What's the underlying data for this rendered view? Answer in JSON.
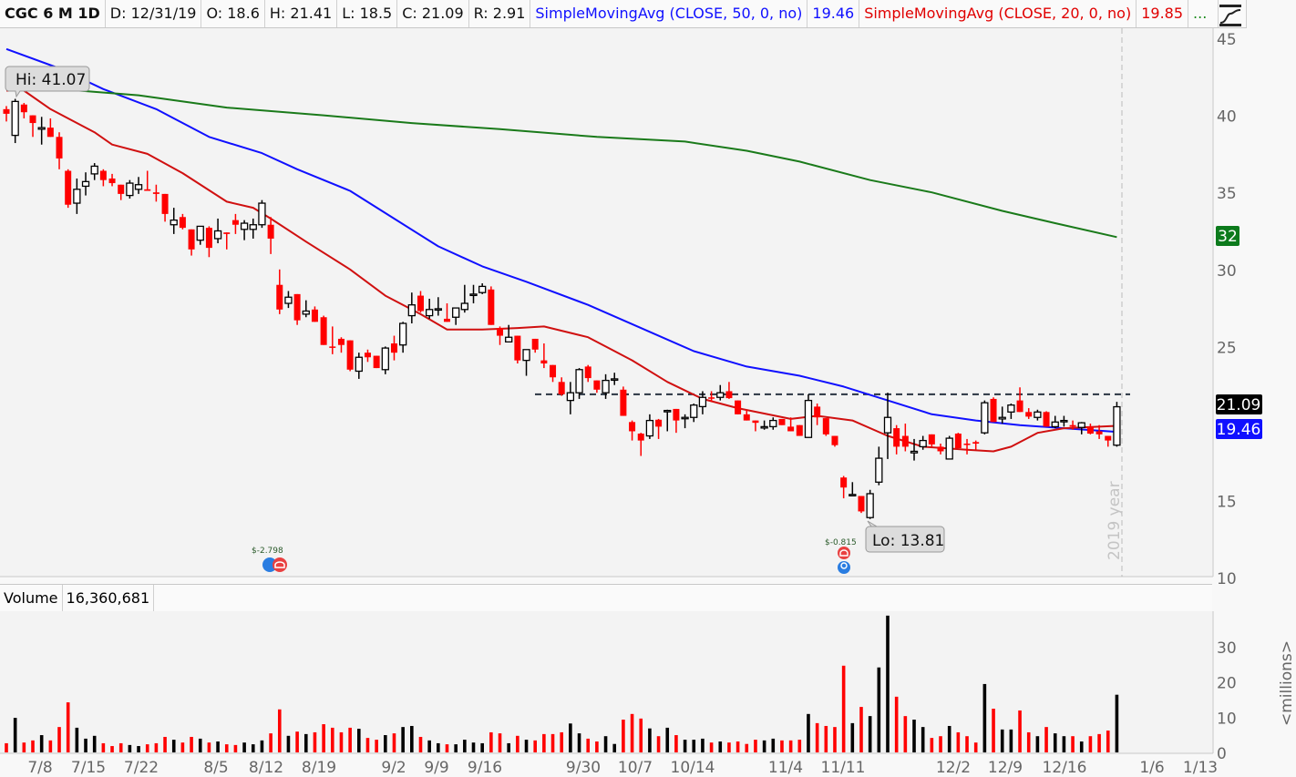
{
  "header": {
    "symbol": "CGC 6 M 1D",
    "date": "D: 12/31/19",
    "open": "O: 18.6",
    "high": "H: 21.41",
    "low": "L: 18.5",
    "close": "C: 21.09",
    "range": "R: 2.91",
    "sma50_label": "SimpleMovingAvg (CLOSE, 50, 0, no)",
    "sma50_value": "19.46",
    "sma20_label": "SimpleMovingAvg (CLOSE, 20, 0, no)",
    "sma20_value": "19.85",
    "more": "..."
  },
  "volume_header": {
    "label": "Volume",
    "value": "16,360,681"
  },
  "annotations": {
    "hi_label": "Hi: 41.07",
    "lo_label": "Lo: 13.81",
    "year_marker": "2019 year",
    "earnings_1": "$-2.798",
    "earnings_2": "$-0.815",
    "horizontal_line_price": 21.9
  },
  "price_labels": {
    "last": "21.09",
    "sma50": "19.46",
    "sma200": "32"
  },
  "colors": {
    "up_candle": "#000000",
    "down_candle": "#ff0000",
    "sma50": "#1010ff",
    "sma20": "#d01010",
    "sma200": "#1a7a1a",
    "volume_r": "#ff0000",
    "volume_k": "#000000"
  },
  "icons": {
    "style": "chart-style-icon",
    "earnings": "phone-icon",
    "dividend": "bulb-icon"
  },
  "chart_data": [
    {
      "type": "candlestick",
      "ylim": [
        10,
        45
      ],
      "y_ticks": [
        "45",
        "40",
        "35",
        "30",
        "25",
        "15",
        "10"
      ],
      "x_ticks": [
        "7/8",
        "7/15",
        "7/22",
        "8/5",
        "8/12",
        "8/19",
        "9/2",
        "9/9",
        "9/16",
        "9/30",
        "10/7",
        "10/14",
        "11/4",
        "11/11",
        "12/2",
        "12/9",
        "12/16",
        "1/6",
        "1/13"
      ],
      "grid": false,
      "ohlc": [
        [
          40.4,
          40.6,
          39.6,
          40.1
        ],
        [
          38.7,
          41.07,
          38.2,
          40.9
        ],
        [
          40.7,
          40.8,
          39.8,
          40.2
        ],
        [
          40.0,
          40.0,
          38.6,
          39.5
        ],
        [
          39.1,
          39.9,
          38.1,
          39.2
        ],
        [
          39.2,
          39.8,
          38.6,
          38.6
        ],
        [
          38.6,
          38.9,
          36.5,
          37.2
        ],
        [
          36.4,
          36.5,
          34.0,
          34.2
        ],
        [
          34.3,
          35.9,
          33.6,
          35.2
        ],
        [
          35.4,
          36.3,
          34.8,
          35.7
        ],
        [
          36.2,
          36.9,
          35.8,
          36.7
        ],
        [
          36.4,
          36.5,
          35.4,
          35.8
        ],
        [
          35.9,
          36.2,
          35.4,
          35.6
        ],
        [
          35.5,
          35.5,
          34.5,
          34.9
        ],
        [
          34.8,
          35.8,
          34.6,
          35.6
        ],
        [
          35.2,
          36.0,
          34.9,
          35.5
        ],
        [
          35.2,
          36.4,
          35.1,
          35.1
        ],
        [
          35.0,
          35.5,
          34.4,
          34.9
        ],
        [
          34.9,
          34.9,
          33.1,
          33.6
        ],
        [
          32.9,
          34.0,
          32.3,
          33.2
        ],
        [
          33.4,
          33.6,
          32.6,
          32.7
        ],
        [
          32.6,
          32.6,
          30.9,
          31.3
        ],
        [
          31.9,
          32.8,
          31.6,
          32.8
        ],
        [
          32.7,
          32.8,
          30.8,
          31.4
        ],
        [
          32.0,
          33.3,
          31.7,
          32.5
        ],
        [
          32.4,
          32.4,
          31.3,
          32.3
        ],
        [
          33.2,
          33.6,
          32.3,
          32.9
        ],
        [
          32.6,
          33.2,
          31.9,
          33.0
        ],
        [
          32.6,
          33.3,
          32.0,
          32.9
        ],
        [
          32.9,
          34.5,
          32.7,
          34.3
        ],
        [
          32.9,
          33.4,
          31.0,
          32.0
        ],
        [
          29.0,
          30.0,
          27.1,
          27.4
        ],
        [
          27.8,
          28.6,
          27.5,
          28.2
        ],
        [
          28.4,
          28.4,
          26.4,
          26.7
        ],
        [
          27.1,
          28.0,
          26.9,
          27.3
        ],
        [
          27.4,
          27.6,
          26.6,
          26.6
        ],
        [
          26.9,
          27.0,
          25.1,
          25.1
        ],
        [
          25.0,
          26.3,
          24.5,
          24.95
        ],
        [
          25.5,
          25.6,
          24.6,
          25.1
        ],
        [
          25.4,
          25.4,
          23.4,
          23.5
        ],
        [
          23.4,
          24.6,
          22.9,
          24.3
        ],
        [
          24.6,
          24.8,
          24.0,
          24.3
        ],
        [
          24.4,
          24.4,
          23.6,
          23.6
        ],
        [
          23.5,
          25.0,
          23.2,
          24.9
        ],
        [
          25.2,
          25.7,
          24.1,
          24.6
        ],
        [
          25.1,
          26.6,
          24.6,
          26.5
        ],
        [
          27.0,
          28.5,
          26.5,
          27.7
        ],
        [
          28.3,
          28.6,
          27.2,
          27.3
        ],
        [
          27.0,
          28.1,
          26.8,
          27.4
        ],
        [
          27.4,
          28.2,
          27.0,
          27.45
        ],
        [
          26.8,
          27.8,
          26.6,
          26.6
        ],
        [
          26.9,
          27.5,
          26.4,
          27.5
        ],
        [
          27.4,
          29.0,
          27.2,
          27.8
        ],
        [
          28.35,
          29.0,
          27.8,
          28.4
        ],
        [
          28.5,
          29.1,
          28.4,
          28.9
        ],
        [
          28.7,
          28.9,
          26.4,
          26.4
        ],
        [
          26.2,
          26.3,
          25.1,
          25.7
        ],
        [
          25.3,
          26.4,
          25.3,
          25.6
        ],
        [
          25.7,
          25.7,
          23.9,
          24.1
        ],
        [
          24.1,
          24.8,
          23.1,
          24.8
        ],
        [
          25.5,
          25.5,
          24.6,
          24.8
        ],
        [
          24.1,
          25.2,
          23.6,
          23.9
        ],
        [
          23.8,
          23.8,
          22.7,
          23.0
        ],
        [
          22.7,
          23.0,
          21.8,
          21.9
        ],
        [
          21.5,
          22.7,
          20.6,
          22.0
        ],
        [
          22.0,
          23.6,
          21.6,
          23.5
        ],
        [
          23.7,
          23.8,
          22.7,
          22.95
        ],
        [
          22.8,
          22.8,
          22.0,
          22.2
        ],
        [
          22.0,
          23.2,
          21.6,
          22.8
        ],
        [
          22.85,
          23.3,
          22.5,
          22.9
        ],
        [
          22.2,
          22.4,
          20.5,
          20.5
        ],
        [
          20.1,
          20.2,
          18.9,
          19.5
        ],
        [
          19.35,
          19.4,
          17.9,
          18.9
        ],
        [
          19.2,
          20.6,
          19.0,
          20.2
        ],
        [
          20.25,
          20.3,
          19.0,
          19.8
        ],
        [
          20.8,
          20.9,
          19.5,
          20.85
        ],
        [
          20.95,
          20.95,
          19.4,
          20.2
        ],
        [
          20.35,
          20.6,
          19.7,
          20.4
        ],
        [
          20.4,
          21.3,
          20.1,
          21.2
        ],
        [
          21.1,
          22.1,
          20.6,
          21.7
        ],
        [
          21.7,
          22.1,
          21.4,
          21.65
        ],
        [
          21.7,
          22.5,
          21.5,
          22.0
        ],
        [
          22.1,
          22.7,
          21.6,
          21.65
        ],
        [
          21.5,
          21.5,
          20.6,
          20.6
        ],
        [
          20.6,
          20.9,
          20.2,
          20.2
        ],
        [
          20.2,
          20.2,
          19.5,
          20.05
        ],
        [
          19.75,
          20.2,
          19.6,
          19.8
        ],
        [
          19.8,
          20.4,
          19.6,
          20.2
        ],
        [
          20.3,
          20.3,
          19.9,
          19.9
        ],
        [
          19.8,
          20.4,
          19.5,
          19.5
        ],
        [
          19.9,
          19.9,
          19.2,
          19.2
        ],
        [
          19.1,
          21.9,
          19.1,
          21.5
        ],
        [
          21.1,
          21.3,
          19.9,
          20.4
        ],
        [
          20.35,
          20.35,
          19.2,
          19.3
        ],
        [
          19.2,
          19.2,
          18.5,
          18.6
        ],
        [
          16.5,
          16.6,
          15.15,
          15.85
        ],
        [
          15.35,
          16.2,
          15.3,
          15.4
        ],
        [
          15.3,
          15.3,
          14.2,
          14.3
        ],
        [
          13.9,
          15.7,
          13.81,
          15.45
        ],
        [
          16.2,
          18.5,
          16.0,
          17.75
        ],
        [
          19.4,
          22.0,
          17.7,
          20.4
        ],
        [
          19.7,
          19.9,
          18.0,
          18.5
        ],
        [
          19.2,
          20.0,
          18.2,
          18.5
        ],
        [
          18.1,
          19.0,
          17.6,
          18.2
        ],
        [
          18.5,
          19.2,
          18.3,
          18.9
        ],
        [
          19.3,
          19.3,
          18.5,
          18.65
        ],
        [
          18.5,
          18.7,
          18.0,
          18.2
        ],
        [
          17.7,
          19.2,
          17.7,
          19.05
        ],
        [
          19.35,
          19.4,
          18.4,
          18.4
        ],
        [
          18.7,
          19.0,
          18.0,
          18.65
        ],
        [
          18.8,
          18.9,
          18.3,
          18.7
        ],
        [
          19.4,
          21.5,
          19.3,
          21.35
        ],
        [
          21.6,
          21.7,
          20.1,
          20.1
        ],
        [
          20.3,
          21.1,
          20.0,
          20.4
        ],
        [
          20.75,
          21.3,
          20.3,
          21.2
        ],
        [
          21.5,
          22.35,
          20.75,
          20.75
        ],
        [
          20.75,
          21.0,
          20.3,
          20.45
        ],
        [
          20.4,
          20.9,
          20.2,
          20.75
        ],
        [
          20.75,
          20.8,
          19.8,
          19.8
        ],
        [
          19.8,
          20.5,
          19.7,
          20.1
        ],
        [
          20.15,
          20.5,
          19.8,
          20.2
        ],
        [
          19.9,
          20.2,
          19.6,
          19.8
        ],
        [
          19.75,
          20.1,
          19.3,
          20.05
        ],
        [
          19.8,
          20.0,
          19.3,
          19.35
        ],
        [
          19.5,
          19.9,
          19.0,
          19.3
        ],
        [
          19.2,
          19.2,
          18.5,
          18.9
        ],
        [
          18.6,
          21.41,
          18.5,
          21.09
        ]
      ],
      "series": [
        {
          "name": "SimpleMovingAvg (CLOSE, 50, 0, no)",
          "points": [
            [
              0,
              44.3
            ],
            [
              6,
              43.05
            ],
            [
              11,
              41.7
            ],
            [
              17,
              40.4
            ],
            [
              23,
              38.6
            ],
            [
              29,
              37.55
            ],
            [
              33,
              36.5
            ],
            [
              39,
              35.1
            ],
            [
              44,
              33.3
            ],
            [
              49,
              31.5
            ],
            [
              54,
              30.2
            ],
            [
              59,
              29.2
            ],
            [
              66,
              27.7
            ],
            [
              72,
              26.2
            ],
            [
              78,
              24.7
            ],
            [
              84,
              23.7
            ],
            [
              90,
              23.1
            ],
            [
              95,
              22.4
            ],
            [
              100,
              21.5
            ],
            [
              105,
              20.6
            ],
            [
              110,
              20.2
            ],
            [
              115,
              19.9
            ],
            [
              120,
              19.7
            ],
            [
              126,
              19.46
            ]
          ]
        },
        {
          "name": "SimpleMovingAvg (CLOSE, 20, 0, no)",
          "points": [
            [
              0,
              41.6
            ],
            [
              2,
              41.6
            ],
            [
              5,
              40.4
            ],
            [
              10,
              38.9
            ],
            [
              12,
              38.1
            ],
            [
              16,
              37.5
            ],
            [
              20,
              36.25
            ],
            [
              25,
              34.4
            ],
            [
              28,
              34.0
            ],
            [
              30,
              33.3
            ],
            [
              34,
              31.8
            ],
            [
              39,
              30.0
            ],
            [
              43,
              28.3
            ],
            [
              47,
              27.1
            ],
            [
              50,
              26.1
            ],
            [
              54,
              26.1
            ],
            [
              58,
              26.2
            ],
            [
              61,
              26.3
            ],
            [
              66,
              25.6
            ],
            [
              71,
              24.1
            ],
            [
              75,
              22.7
            ],
            [
              79,
              21.6
            ],
            [
              83,
              21.0
            ],
            [
              89,
              20.3
            ],
            [
              92,
              20.5
            ],
            [
              96,
              20.2
            ],
            [
              100,
              19.2
            ],
            [
              104,
              18.5
            ],
            [
              109,
              18.3
            ],
            [
              112,
              18.2
            ],
            [
              114,
              18.5
            ],
            [
              117,
              19.4
            ],
            [
              120,
              19.7
            ],
            [
              126,
              19.85
            ]
          ]
        },
        {
          "points": [
            [
              0,
              42.3
            ],
            [
              6,
              41.7
            ],
            [
              15,
              41.3
            ],
            [
              25,
              40.5
            ],
            [
              36,
              40.0
            ],
            [
              46,
              39.5
            ],
            [
              56,
              39.1
            ],
            [
              67,
              38.6
            ],
            [
              77,
              38.3
            ],
            [
              84,
              37.7
            ],
            [
              90,
              37.0
            ],
            [
              98,
              35.8
            ],
            [
              105,
              35.0
            ],
            [
              113,
              33.8
            ],
            [
              119,
              33.0
            ],
            [
              126,
              32.1
            ]
          ]
        }
      ]
    },
    {
      "type": "bar",
      "ylabel": "<millions>",
      "y_ticks": [
        "30",
        "20",
        "10",
        "0"
      ],
      "ylim": [
        0,
        40
      ],
      "values": [
        2.6,
        9.8,
        2.8,
        3.4,
        4.9,
        3.4,
        7.2,
        14.2,
        7.0,
        3.9,
        4.7,
        2.6,
        1.8,
        2.6,
        2.1,
        1.8,
        2.3,
        2.6,
        4.4,
        3.6,
        2.8,
        4.4,
        3.9,
        2.8,
        3.1,
        2.3,
        2.1,
        2.8,
        2.3,
        3.4,
        5.4,
        12.2,
        4.7,
        5.9,
        5.2,
        5.7,
        8.0,
        7.0,
        5.7,
        7.0,
        6.7,
        4.1,
        3.6,
        4.9,
        5.4,
        7.2,
        7.5,
        4.4,
        3.4,
        2.6,
        2.3,
        2.3,
        3.6,
        2.8,
        2.6,
        5.7,
        5.4,
        2.6,
        4.7,
        3.6,
        3.4,
        5.2,
        5.2,
        5.7,
        8.2,
        5.4,
        3.9,
        3.1,
        4.6,
        2.4,
        9.3,
        10.9,
        9.6,
        6.8,
        4.6,
        7.0,
        4.9,
        3.6,
        3.6,
        3.9,
        2.8,
        3.1,
        2.8,
        3.1,
        2.4,
        3.6,
        3.4,
        3.9,
        3.4,
        3.4,
        3.6,
        10.9,
        8.3,
        7.5,
        7.2,
        24.6,
        8.3,
        12.9,
        10.3,
        24.1,
        38.8,
        15.8,
        10.3,
        9.3,
        7.2,
        4.1,
        4.6,
        7.5,
        5.7,
        4.6,
        2.8,
        19.4,
        12.4,
        6.5,
        6.5,
        11.9,
        5.7,
        4.6,
        7.2,
        5.4,
        4.6,
        4.6,
        3.1,
        4.6,
        5.2,
        6.2,
        16.36
      ],
      "bar_colors": "rkrrkrrrkkkrrrkkrrrkrrkrkrrkkkrrkrkrrrrrkrrkrkkrkkrkkkkrrkrkrrrrkkrrkkrrrkrkrkkkrkrrrrkkrrrkrrrrkrkkkrrkkrrkrrrkrkkrrkrkkrkrrrk"
    }
  ]
}
